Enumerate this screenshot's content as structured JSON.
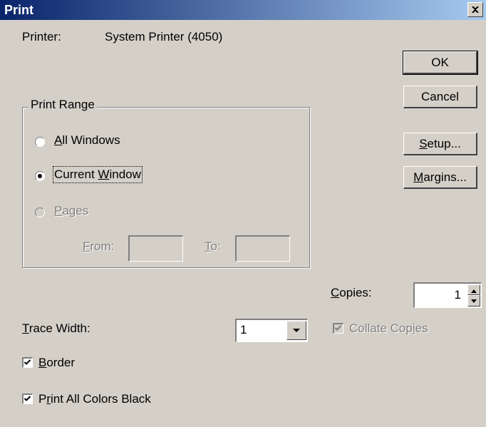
{
  "window": {
    "title": "Print",
    "close_glyph": "×"
  },
  "printer": {
    "label": "Printer:",
    "value": "System Printer (4050)"
  },
  "buttons": {
    "ok": "OK",
    "cancel": "Cancel",
    "setup": {
      "pre": "",
      "key": "S",
      "post": "etup..."
    },
    "margins": {
      "pre": "",
      "key": "M",
      "post": "argins..."
    }
  },
  "print_range": {
    "label": "Print Range",
    "options": [
      {
        "pre": "",
        "key": "A",
        "post": "ll Windows",
        "selected": false,
        "disabled": false
      },
      {
        "pre": "Current ",
        "key": "W",
        "post": "indow",
        "selected": true,
        "disabled": false
      },
      {
        "pre": "",
        "key": "P",
        "post": "ages",
        "selected": false,
        "disabled": true
      }
    ],
    "from": {
      "pre": "",
      "key": "F",
      "post": "rom:",
      "value": ""
    },
    "to": {
      "pre": "",
      "key": "T",
      "post": "o:",
      "value": ""
    }
  },
  "copies": {
    "pre": "",
    "key": "C",
    "post": "opies:",
    "value": "1"
  },
  "collate": {
    "pre": "Collate Cop",
    "key": "i",
    "post": "es",
    "checked": true,
    "disabled": true
  },
  "trace_width": {
    "pre": "",
    "key": "T",
    "post": "race Width:",
    "value": "1"
  },
  "border": {
    "pre": "",
    "key": "B",
    "post": "order",
    "checked": true
  },
  "print_all_black": {
    "pre": "P",
    "key": "r",
    "post": "int All Colors Black",
    "checked": true
  },
  "colors": {
    "face": "#d4d0c8",
    "title_start": "#0a246a",
    "title_end": "#a6caf0",
    "disabled": "#808080"
  },
  "icons": {
    "close": "close-icon",
    "spin_up": "arrow-up-icon",
    "spin_down": "arrow-down-icon",
    "dropdown": "chevron-down-icon",
    "check": "checkmark-icon"
  }
}
